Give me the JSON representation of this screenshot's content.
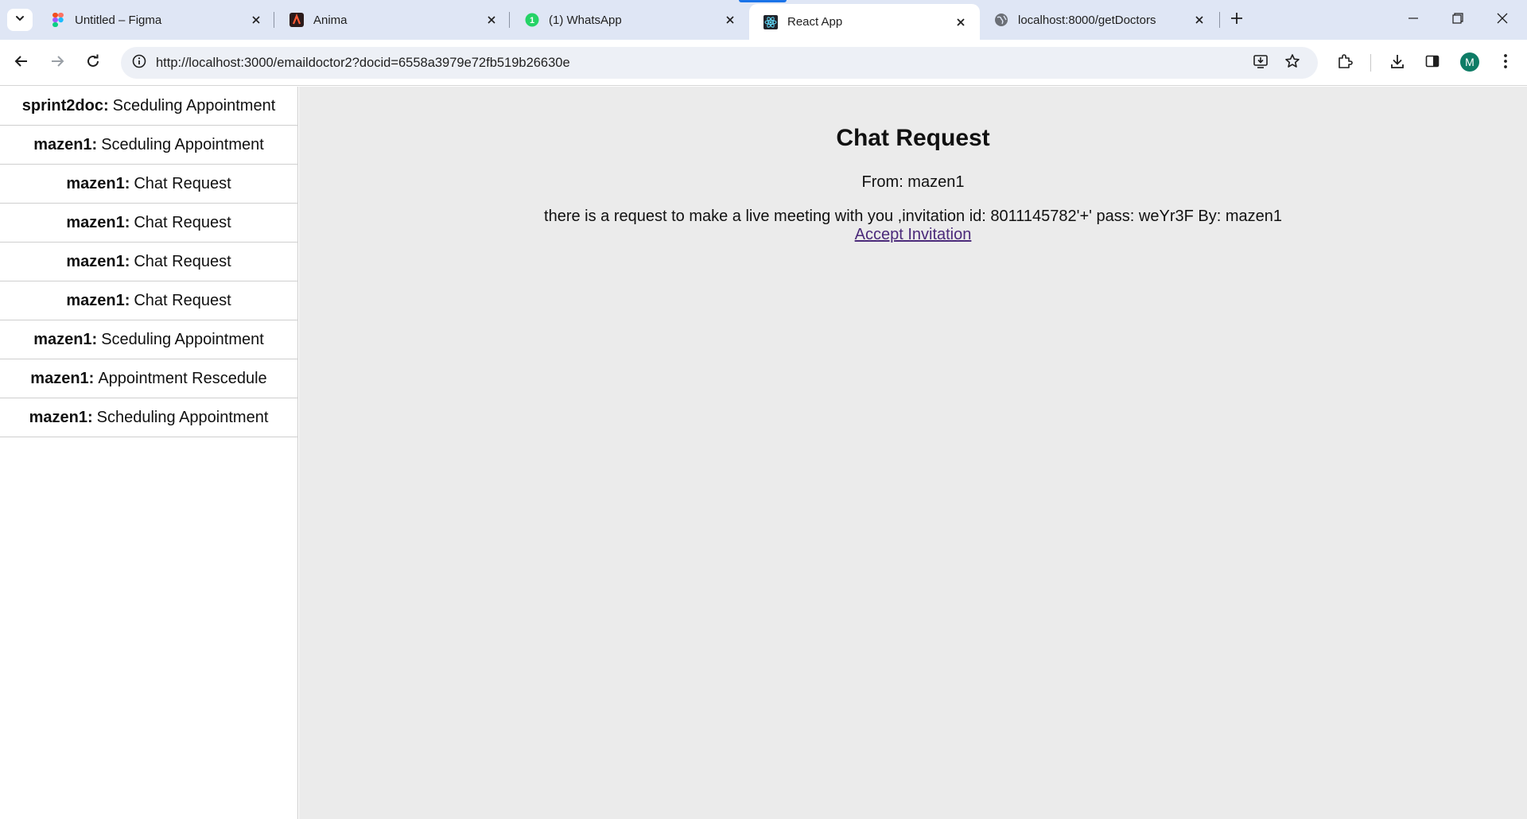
{
  "browser": {
    "tabs": [
      {
        "title": "Untitled – Figma",
        "icon": "figma-icon",
        "active": false
      },
      {
        "title": "Anima",
        "icon": "anima-icon",
        "active": false
      },
      {
        "title": "(1) WhatsApp",
        "icon": "whatsapp-icon",
        "active": false
      },
      {
        "title": "React App",
        "icon": "react-icon",
        "active": true
      },
      {
        "title": "localhost:8000/getDoctors",
        "icon": "globe-icon",
        "active": false
      }
    ],
    "url": "http://localhost:3000/emaildoctor2?docid=6558a3979e72fb519b26630e",
    "profile_initial": "M",
    "accent_color": "#1a73e8",
    "profile_color": "#0e7c66"
  },
  "sidebar": {
    "items": [
      {
        "sender": "sprint2doc:",
        "subject": "Sceduling Appointment"
      },
      {
        "sender": "mazen1:",
        "subject": "Sceduling Appointment"
      },
      {
        "sender": "mazen1:",
        "subject": "Chat Request"
      },
      {
        "sender": "mazen1:",
        "subject": "Chat Request"
      },
      {
        "sender": "mazen1:",
        "subject": "Chat Request"
      },
      {
        "sender": "mazen1:",
        "subject": "Chat Request"
      },
      {
        "sender": "mazen1:",
        "subject": "Sceduling Appointment"
      },
      {
        "sender": "mazen1:",
        "subject": "Appointment Rescedule"
      },
      {
        "sender": "mazen1:",
        "subject": "Scheduling Appointment"
      }
    ]
  },
  "message": {
    "title": "Chat Request",
    "from": "From: mazen1",
    "body": "there is a request to make a live meeting with you ,invitation id: 8011145782'+' pass: weYr3F By: mazen1",
    "accept_label": "Accept Invitation",
    "link_color": "#4b2a7a"
  }
}
